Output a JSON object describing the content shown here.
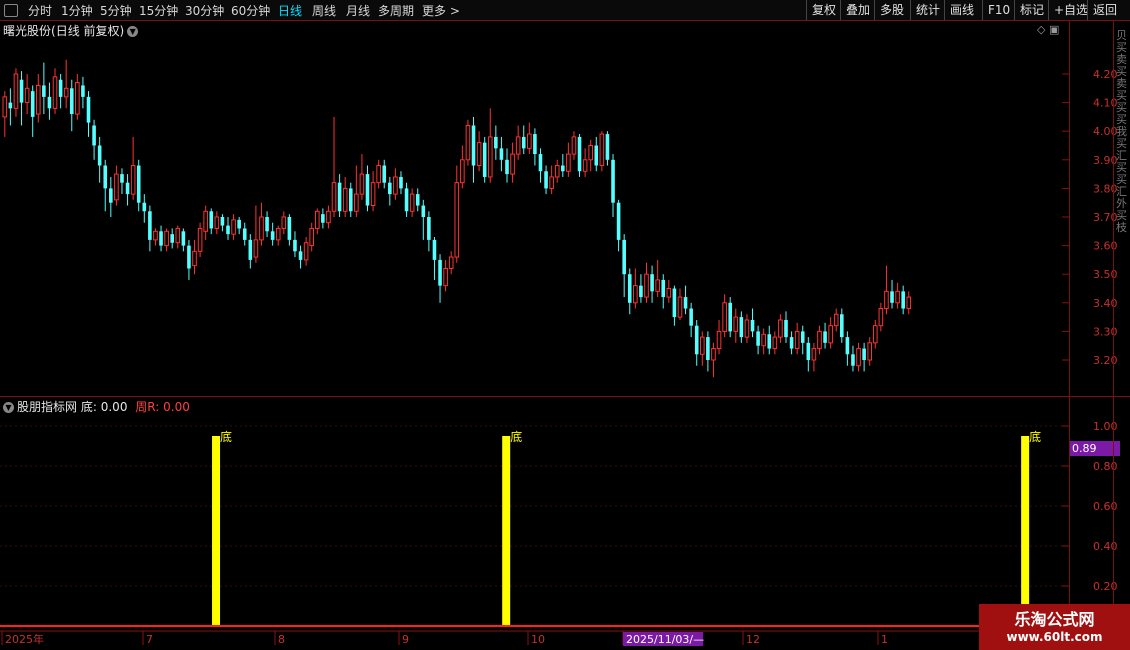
{
  "toolbar": {
    "left": [
      "分时",
      "1分钟",
      "5分钟",
      "15分钟",
      "30分钟",
      "60分钟",
      "日线",
      "周线",
      "月线",
      "多周期",
      "更多"
    ],
    "active": "日线",
    "right": [
      "复权",
      "叠加",
      "多股",
      "统计",
      "画线",
      "F10",
      "标记",
      "+自选",
      "返回"
    ]
  },
  "chart": {
    "stock_name": "曙光股份",
    "period_label": "(日线 前复权)",
    "price_ticks": [
      "4.20",
      "4.10",
      "4.00",
      "3.90",
      "3.80",
      "3.70",
      "3.60",
      "3.50",
      "3.40",
      "3.30",
      "3.20"
    ],
    "price_ticks_values": [
      4.2,
      4.1,
      4.0,
      3.9,
      3.8,
      3.7,
      3.6,
      3.5,
      3.4,
      3.3,
      3.2
    ]
  },
  "chart_data": {
    "type": "candlestick+bar",
    "series": [
      {
        "name": "曙光股份",
        "note": "daily candles",
        "ohlc": [
          [
            4.05,
            4.12,
            3.98,
            4.14
          ],
          [
            4.1,
            4.08,
            4.02,
            4.15
          ],
          [
            4.08,
            4.2,
            4.05,
            4.22
          ],
          [
            4.18,
            4.1,
            4.02,
            4.21
          ],
          [
            4.1,
            4.15,
            4.06,
            4.2
          ],
          [
            4.14,
            4.05,
            3.98,
            4.16
          ],
          [
            4.06,
            4.16,
            4.03,
            4.2
          ],
          [
            4.16,
            4.12,
            4.06,
            4.24
          ],
          [
            4.12,
            4.08,
            4.04,
            4.17
          ],
          [
            4.08,
            4.19,
            4.06,
            4.22
          ],
          [
            4.18,
            4.12,
            4.08,
            4.2
          ],
          [
            4.12,
            4.15,
            4.08,
            4.25
          ],
          [
            4.15,
            4.06,
            4.0,
            4.18
          ],
          [
            4.06,
            4.17,
            4.04,
            4.2
          ],
          [
            4.16,
            4.12,
            4.08,
            4.19
          ],
          [
            4.12,
            4.03,
            3.98,
            4.14
          ],
          [
            4.02,
            3.95,
            3.9,
            4.04
          ],
          [
            3.95,
            3.88,
            3.82,
            3.98
          ],
          [
            3.88,
            3.8,
            3.72,
            3.9
          ],
          [
            3.8,
            3.75,
            3.7,
            3.84
          ],
          [
            3.76,
            3.85,
            3.74,
            3.88
          ],
          [
            3.85,
            3.82,
            3.78,
            3.87
          ],
          [
            3.82,
            3.78,
            3.74,
            3.85
          ],
          [
            3.78,
            3.88,
            3.76,
            3.98
          ],
          [
            3.88,
            3.75,
            3.72,
            3.9
          ],
          [
            3.75,
            3.72,
            3.68,
            3.78
          ],
          [
            3.72,
            3.62,
            3.58,
            3.74
          ],
          [
            3.62,
            3.65,
            3.6,
            3.66
          ],
          [
            3.65,
            3.6,
            3.58,
            3.67
          ],
          [
            3.6,
            3.65,
            3.58,
            3.66
          ],
          [
            3.64,
            3.61,
            3.59,
            3.66
          ],
          [
            3.61,
            3.66,
            3.59,
            3.67
          ],
          [
            3.65,
            3.6,
            3.58,
            3.66
          ],
          [
            3.6,
            3.52,
            3.48,
            3.62
          ],
          [
            3.53,
            3.58,
            3.5,
            3.62
          ],
          [
            3.58,
            3.66,
            3.56,
            3.68
          ],
          [
            3.65,
            3.72,
            3.62,
            3.74
          ],
          [
            3.72,
            3.66,
            3.64,
            3.73
          ],
          [
            3.66,
            3.7,
            3.64,
            3.72
          ],
          [
            3.7,
            3.67,
            3.65,
            3.71
          ],
          [
            3.67,
            3.64,
            3.62,
            3.7
          ],
          [
            3.64,
            3.69,
            3.62,
            3.71
          ],
          [
            3.69,
            3.66,
            3.64,
            3.7
          ],
          [
            3.66,
            3.62,
            3.6,
            3.68
          ],
          [
            3.62,
            3.55,
            3.52,
            3.64
          ],
          [
            3.56,
            3.62,
            3.54,
            3.74
          ],
          [
            3.62,
            3.7,
            3.6,
            3.75
          ],
          [
            3.7,
            3.65,
            3.63,
            3.72
          ],
          [
            3.65,
            3.62,
            3.6,
            3.68
          ],
          [
            3.62,
            3.66,
            3.6,
            3.67
          ],
          [
            3.66,
            3.7,
            3.64,
            3.72
          ],
          [
            3.7,
            3.62,
            3.6,
            3.71
          ],
          [
            3.62,
            3.58,
            3.56,
            3.65
          ],
          [
            3.58,
            3.55,
            3.52,
            3.6
          ],
          [
            3.55,
            3.61,
            3.53,
            3.63
          ],
          [
            3.6,
            3.66,
            3.58,
            3.68
          ],
          [
            3.66,
            3.72,
            3.64,
            3.73
          ],
          [
            3.71,
            3.68,
            3.66,
            3.73
          ],
          [
            3.68,
            3.72,
            3.66,
            3.74
          ],
          [
            3.72,
            3.82,
            3.7,
            4.05
          ],
          [
            3.82,
            3.72,
            3.7,
            3.85
          ],
          [
            3.72,
            3.8,
            3.7,
            3.84
          ],
          [
            3.8,
            3.72,
            3.7,
            3.82
          ],
          [
            3.72,
            3.78,
            3.7,
            3.88
          ],
          [
            3.78,
            3.85,
            3.76,
            3.92
          ],
          [
            3.85,
            3.74,
            3.72,
            3.88
          ],
          [
            3.74,
            3.82,
            3.72,
            3.86
          ],
          [
            3.82,
            3.88,
            3.8,
            3.9
          ],
          [
            3.88,
            3.82,
            3.8,
            3.9
          ],
          [
            3.82,
            3.78,
            3.74,
            3.84
          ],
          [
            3.78,
            3.84,
            3.76,
            3.87
          ],
          [
            3.84,
            3.8,
            3.78,
            3.86
          ],
          [
            3.8,
            3.72,
            3.7,
            3.82
          ],
          [
            3.72,
            3.78,
            3.7,
            3.8
          ],
          [
            3.78,
            3.74,
            3.72,
            3.8
          ],
          [
            3.74,
            3.7,
            3.62,
            3.76
          ],
          [
            3.7,
            3.62,
            3.58,
            3.72
          ],
          [
            3.62,
            3.55,
            3.48,
            3.63
          ],
          [
            3.55,
            3.46,
            3.4,
            3.57
          ],
          [
            3.46,
            3.52,
            3.44,
            3.55
          ],
          [
            3.52,
            3.56,
            3.5,
            3.58
          ],
          [
            3.56,
            3.82,
            3.54,
            3.88
          ],
          [
            3.82,
            3.9,
            3.8,
            3.95
          ],
          [
            3.9,
            4.02,
            3.88,
            4.04
          ],
          [
            4.02,
            3.88,
            3.82,
            4.05
          ],
          [
            3.88,
            3.96,
            3.86,
            4.0
          ],
          [
            3.96,
            3.84,
            3.82,
            3.98
          ],
          [
            3.84,
            3.98,
            3.82,
            4.08
          ],
          [
            3.98,
            3.94,
            3.9,
            4.02
          ],
          [
            3.94,
            3.9,
            3.86,
            3.98
          ],
          [
            3.9,
            3.85,
            3.82,
            3.94
          ],
          [
            3.85,
            3.92,
            3.82,
            3.96
          ],
          [
            3.92,
            3.98,
            3.9,
            4.02
          ],
          [
            3.98,
            3.94,
            3.92,
            4.02
          ],
          [
            3.94,
            3.99,
            3.92,
            4.03
          ],
          [
            3.99,
            3.92,
            3.88,
            4.01
          ],
          [
            3.92,
            3.86,
            3.82,
            3.94
          ],
          [
            3.86,
            3.8,
            3.78,
            3.88
          ],
          [
            3.8,
            3.84,
            3.78,
            3.88
          ],
          [
            3.84,
            3.88,
            3.82,
            3.9
          ],
          [
            3.88,
            3.86,
            3.84,
            3.92
          ],
          [
            3.86,
            3.92,
            3.84,
            3.96
          ],
          [
            3.92,
            3.98,
            3.9,
            4.0
          ],
          [
            3.98,
            3.86,
            3.84,
            3.99
          ],
          [
            3.86,
            3.9,
            3.84,
            3.94
          ],
          [
            3.9,
            3.95,
            3.86,
            3.97
          ],
          [
            3.95,
            3.88,
            3.86,
            3.98
          ],
          [
            3.88,
            3.99,
            3.86,
            4.0
          ],
          [
            3.99,
            3.9,
            3.88,
            4.0
          ],
          [
            3.9,
            3.75,
            3.7,
            3.92
          ],
          [
            3.75,
            3.62,
            3.58,
            3.76
          ],
          [
            3.62,
            3.5,
            3.42,
            3.64
          ],
          [
            3.5,
            3.4,
            3.36,
            3.52
          ],
          [
            3.4,
            3.46,
            3.38,
            3.52
          ],
          [
            3.46,
            3.42,
            3.4,
            3.5
          ],
          [
            3.42,
            3.5,
            3.4,
            3.54
          ],
          [
            3.5,
            3.44,
            3.4,
            3.53
          ],
          [
            3.44,
            3.48,
            3.42,
            3.55
          ],
          [
            3.48,
            3.42,
            3.38,
            3.5
          ],
          [
            3.42,
            3.45,
            3.4,
            3.48
          ],
          [
            3.45,
            3.35,
            3.32,
            3.46
          ],
          [
            3.35,
            3.42,
            3.34,
            3.45
          ],
          [
            3.42,
            3.38,
            3.36,
            3.46
          ],
          [
            3.38,
            3.32,
            3.28,
            3.4
          ],
          [
            3.32,
            3.22,
            3.18,
            3.34
          ],
          [
            3.22,
            3.28,
            3.18,
            3.3
          ],
          [
            3.28,
            3.2,
            3.16,
            3.3
          ],
          [
            3.2,
            3.24,
            3.14,
            3.26
          ],
          [
            3.24,
            3.3,
            3.22,
            3.34
          ],
          [
            3.3,
            3.4,
            3.28,
            3.43
          ],
          [
            3.4,
            3.3,
            3.28,
            3.42
          ],
          [
            3.3,
            3.35,
            3.26,
            3.38
          ],
          [
            3.35,
            3.28,
            3.26,
            3.37
          ],
          [
            3.28,
            3.34,
            3.26,
            3.36
          ],
          [
            3.34,
            3.3,
            3.28,
            3.38
          ],
          [
            3.3,
            3.25,
            3.22,
            3.32
          ],
          [
            3.25,
            3.29,
            3.22,
            3.31
          ],
          [
            3.29,
            3.24,
            3.22,
            3.32
          ],
          [
            3.24,
            3.28,
            3.22,
            3.3
          ],
          [
            3.28,
            3.34,
            3.26,
            3.36
          ],
          [
            3.34,
            3.28,
            3.26,
            3.37
          ],
          [
            3.28,
            3.24,
            3.22,
            3.3
          ],
          [
            3.24,
            3.3,
            3.22,
            3.33
          ],
          [
            3.3,
            3.26,
            3.22,
            3.32
          ],
          [
            3.26,
            3.2,
            3.16,
            3.28
          ],
          [
            3.2,
            3.24,
            3.16,
            3.26
          ],
          [
            3.24,
            3.3,
            3.22,
            3.32
          ],
          [
            3.3,
            3.26,
            3.24,
            3.33
          ],
          [
            3.26,
            3.32,
            3.24,
            3.35
          ],
          [
            3.32,
            3.36,
            3.3,
            3.38
          ],
          [
            3.36,
            3.28,
            3.26,
            3.38
          ],
          [
            3.28,
            3.22,
            3.18,
            3.3
          ],
          [
            3.22,
            3.18,
            3.16,
            3.25
          ],
          [
            3.18,
            3.24,
            3.16,
            3.26
          ],
          [
            3.24,
            3.2,
            3.16,
            3.26
          ],
          [
            3.2,
            3.26,
            3.18,
            3.28
          ],
          [
            3.26,
            3.32,
            3.24,
            3.34
          ],
          [
            3.32,
            3.38,
            3.3,
            3.4
          ],
          [
            3.38,
            3.44,
            3.36,
            3.53
          ],
          [
            3.44,
            3.4,
            3.38,
            3.48
          ],
          [
            3.4,
            3.44,
            3.38,
            3.47
          ],
          [
            3.44,
            3.38,
            3.36,
            3.46
          ],
          [
            3.38,
            3.42,
            3.36,
            3.44
          ]
        ]
      }
    ],
    "indicator": {
      "name": "股朋指标网",
      "di_label": "底",
      "di_value": "0.00",
      "zhou_label": "周R:",
      "zhou_value": "0.00",
      "bar_value": 0.95,
      "bar_marker": "底",
      "bar_indices": [
        38,
        90,
        183
      ],
      "axis_ticks": [
        "1.00",
        "0.80",
        "0.60",
        "0.40",
        "0.20"
      ],
      "axis_ticks_values": [
        1.0,
        0.8,
        0.6,
        0.4,
        0.2
      ],
      "current_badge": "0.89"
    },
    "x_labels": [
      "2025年",
      "7",
      "8",
      "9",
      "10",
      "2025/11/03/—",
      "12",
      "1"
    ]
  },
  "colors": {
    "up": "#ff3232",
    "down": "#54ffff",
    "bar": "#ffff00",
    "grid": "#8b1010",
    "badge": "#7a1aa6"
  },
  "watermark": {
    "title": "乐淘公式网",
    "url": "www.60lt.com"
  },
  "right_panel_text": "贝买卖买卖买买买我买汇买买汇外买枝"
}
